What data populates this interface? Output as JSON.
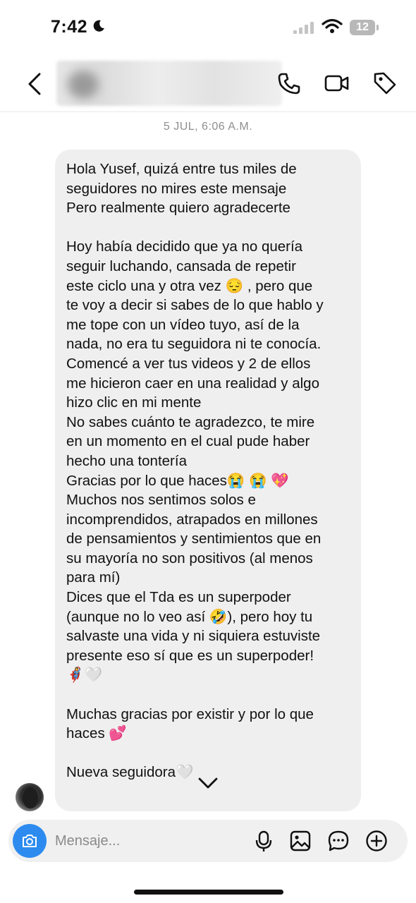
{
  "status_bar": {
    "time": "7:42",
    "battery": "12"
  },
  "header": {
    "contact_name": ""
  },
  "thread": {
    "timestamp": "5 JUL, 6:06 A.M.",
    "message": "Hola Yusef, quizá entre tus miles de\nseguidores no mires este mensaje\nPero realmente quiero agradecerte\n\nHoy había decidido que ya no quería\nseguir luchando, cansada de repetir\neste ciclo una y otra vez 😔 , pero que\nte voy a decir si sabes de lo que hablo y\nme tope con un vídeo tuyo, así de la\nnada, no era tu seguidora ni te conocía.\nComencé a ver tus videos y 2 de ellos\nme hicieron caer en una realidad y algo\nhizo clic en mi mente\nNo sabes cuánto te agradezco, te mire\nen un momento en el cual pude haber\nhecho una tontería\nGracias por lo que haces😭 😭 💖\nMuchos nos sentimos solos e\nincomprendidos, atrapados en millones\nde pensamientos y sentimientos que en\nsu mayoría no son positivos (al menos\npara mí)\nDices que el Tda es un superpoder\n(aunque no lo veo así 🤣), pero hoy tu\nsalvaste una vida y ni siquiera estuviste\npresente eso sí que es un superpoder!\n🦸‍♀️🤍\n\nMuchas gracias por existir y por lo que\nhaces 💕\n\nNueva seguidora🤍"
  },
  "composer": {
    "placeholder": "Mensaje..."
  },
  "icons": {
    "back": "chevron-left-icon",
    "call": "phone-icon",
    "video": "video-camera-icon",
    "tag": "tag-icon",
    "camera": "camera-icon",
    "mic": "microphone-icon",
    "gallery": "image-icon",
    "sticker": "sticker-chat-icon",
    "add": "plus-icon"
  },
  "colors": {
    "accent": "#2d8bf0",
    "bubble": "#efefef",
    "meta_text": "#8e8e8e"
  }
}
